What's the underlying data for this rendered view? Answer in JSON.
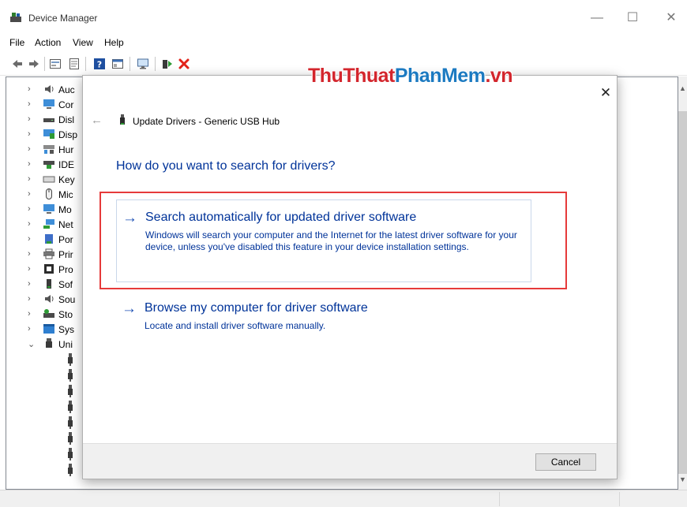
{
  "window": {
    "title": "Device Manager",
    "minimize_glyph": "—",
    "maximize_glyph": "☐",
    "close_glyph": "✕"
  },
  "menu": [
    "File",
    "Action",
    "View",
    "Help"
  ],
  "toolbar": {
    "icons": [
      "back-icon",
      "forward-icon",
      "properties-icon",
      "view-icon",
      "help-icon",
      "details-icon",
      "monitor-icon",
      "update-driver-icon",
      "uninstall-icon"
    ]
  },
  "tree": {
    "items": [
      {
        "label": "Auc",
        "icon": "audio-icon",
        "expanded": false
      },
      {
        "label": "Cor",
        "icon": "computer-icon",
        "expanded": false
      },
      {
        "label": "Disl",
        "icon": "disk-icon",
        "expanded": false
      },
      {
        "label": "Disp",
        "icon": "display-icon",
        "expanded": false
      },
      {
        "label": "Hur",
        "icon": "hid-icon",
        "expanded": false
      },
      {
        "label": "IDE",
        "icon": "ide-icon",
        "expanded": false
      },
      {
        "label": "Key",
        "icon": "keyboard-icon",
        "expanded": false
      },
      {
        "label": "Mic",
        "icon": "mouse-icon",
        "expanded": false
      },
      {
        "label": "Mo",
        "icon": "monitor-icon",
        "expanded": false
      },
      {
        "label": "Net",
        "icon": "network-icon",
        "expanded": false
      },
      {
        "label": "Por",
        "icon": "port-icon",
        "expanded": false
      },
      {
        "label": "Prir",
        "icon": "printer-icon",
        "expanded": false
      },
      {
        "label": "Pro",
        "icon": "processor-icon",
        "expanded": false
      },
      {
        "label": "Sof",
        "icon": "software-icon",
        "expanded": false
      },
      {
        "label": "Sou",
        "icon": "sound-icon",
        "expanded": false
      },
      {
        "label": "Sto",
        "icon": "storage-icon",
        "expanded": false
      },
      {
        "label": "Sys",
        "icon": "system-icon",
        "expanded": false
      },
      {
        "label": "Uni",
        "icon": "usb-icon",
        "expanded": true
      }
    ],
    "collapsed_glyph": "›",
    "expanded_glyph": "⌄"
  },
  "watermark": {
    "part1": "ThuThuat",
    "part2": "PhanMem",
    "part3": ".vn"
  },
  "dialog": {
    "close_glyph": "✕",
    "back_glyph": "←",
    "title": "Update Drivers - Generic USB Hub",
    "question": "How do you want to search for drivers?",
    "option1": {
      "arrow": "→",
      "title": "Search automatically for updated driver software",
      "description": "Windows will search your computer and the Internet for the latest driver software for your device, unless you've disabled this feature in your device installation settings."
    },
    "option2": {
      "arrow": "→",
      "title": "Browse my computer for driver software",
      "description": "Locate and install driver software manually."
    },
    "cancel_label": "Cancel"
  },
  "colors": {
    "link_blue": "#003399",
    "highlight_red": "#e63a3a",
    "watermark_red": "#d3262d",
    "watermark_blue": "#1c7ac1"
  }
}
